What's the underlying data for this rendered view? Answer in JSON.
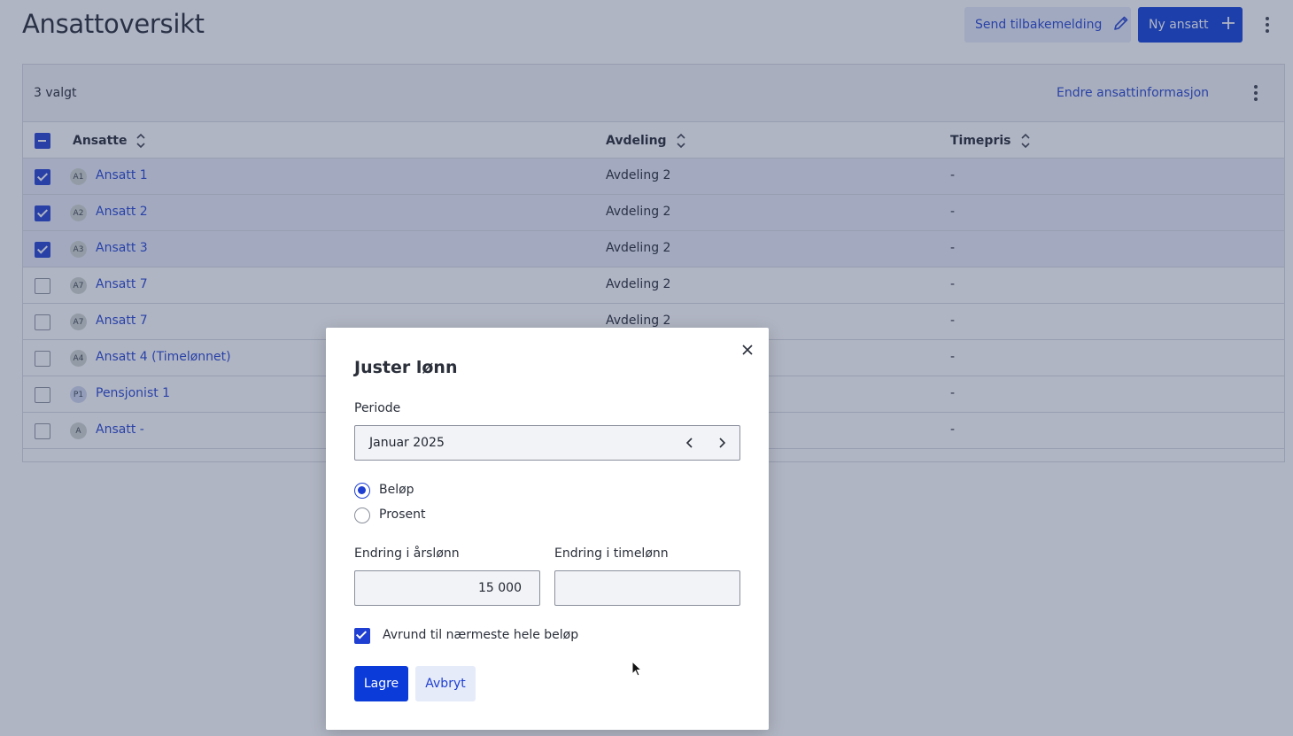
{
  "page": {
    "title": "Ansattoversikt",
    "feedback_button": "Send tilbakemelding",
    "new_employee_button": "Ny ansatt"
  },
  "table": {
    "selected_count": "3 valgt",
    "edit_link": "Endre ansattinformasjon",
    "columns": {
      "employees": "Ansatte",
      "department": "Avdeling",
      "hourly_rate": "Timepris"
    },
    "rows": [
      {
        "initials": "A1",
        "name": "Ansatt 1",
        "department": "Avdeling 2",
        "rate": "-",
        "selected": true
      },
      {
        "initials": "A2",
        "name": "Ansatt 2",
        "department": "Avdeling 2",
        "rate": "-",
        "selected": true
      },
      {
        "initials": "A3",
        "name": "Ansatt 3",
        "department": "Avdeling 2",
        "rate": "-",
        "selected": true
      },
      {
        "initials": "A7",
        "name": "Ansatt 7",
        "department": "Avdeling 2",
        "rate": "-",
        "selected": false
      },
      {
        "initials": "A7",
        "name": "Ansatt 7",
        "department": "Avdeling 2",
        "rate": "-",
        "selected": false
      },
      {
        "initials": "A4",
        "name": "Ansatt 4 (Timelønnet)",
        "department": "",
        "rate": "-",
        "selected": false
      },
      {
        "initials": "P1",
        "name": "Pensjonist 1",
        "department": "",
        "rate": "-",
        "selected": false
      },
      {
        "initials": "A",
        "name": "Ansatt -",
        "department": "",
        "rate": "-",
        "selected": false
      }
    ]
  },
  "modal": {
    "title": "Juster lønn",
    "period_label": "Periode",
    "period_value": "Januar 2025",
    "radio_amount": "Beløp",
    "radio_percent": "Prosent",
    "annual_label": "Endring i årslønn",
    "annual_value": "15 000",
    "hourly_label": "Endring i timelønn",
    "hourly_value": "",
    "round_label": "Avrund til nærmeste hele beløp",
    "save_button": "Lagre",
    "cancel_button": "Avbryt"
  },
  "colors": {
    "accent": "#1e3fd1",
    "primary_button": "#0b3bd8",
    "secondary_button": "#e6ebfa"
  }
}
